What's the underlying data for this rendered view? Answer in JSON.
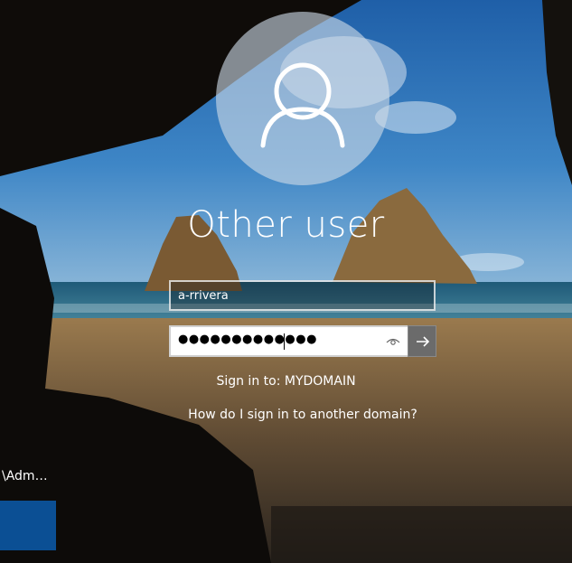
{
  "screen": {
    "title": "Other user"
  },
  "username_field": {
    "value": "a-rrivera"
  },
  "password_field": {
    "masked_value": "●●●●●●●●●●●●●",
    "reveal_icon": "eye-icon",
    "submit_icon": "arrow-right-icon"
  },
  "sign_in_to": {
    "text": "Sign in to: MYDOMAIN"
  },
  "help_link": {
    "text": "How do I sign in to another domain?"
  },
  "user_list": {
    "items": [
      {
        "label": "\\Adm…"
      }
    ]
  },
  "colors": {
    "tile_accent": "#0b4f94",
    "submit_button": "#6b6b6b"
  }
}
